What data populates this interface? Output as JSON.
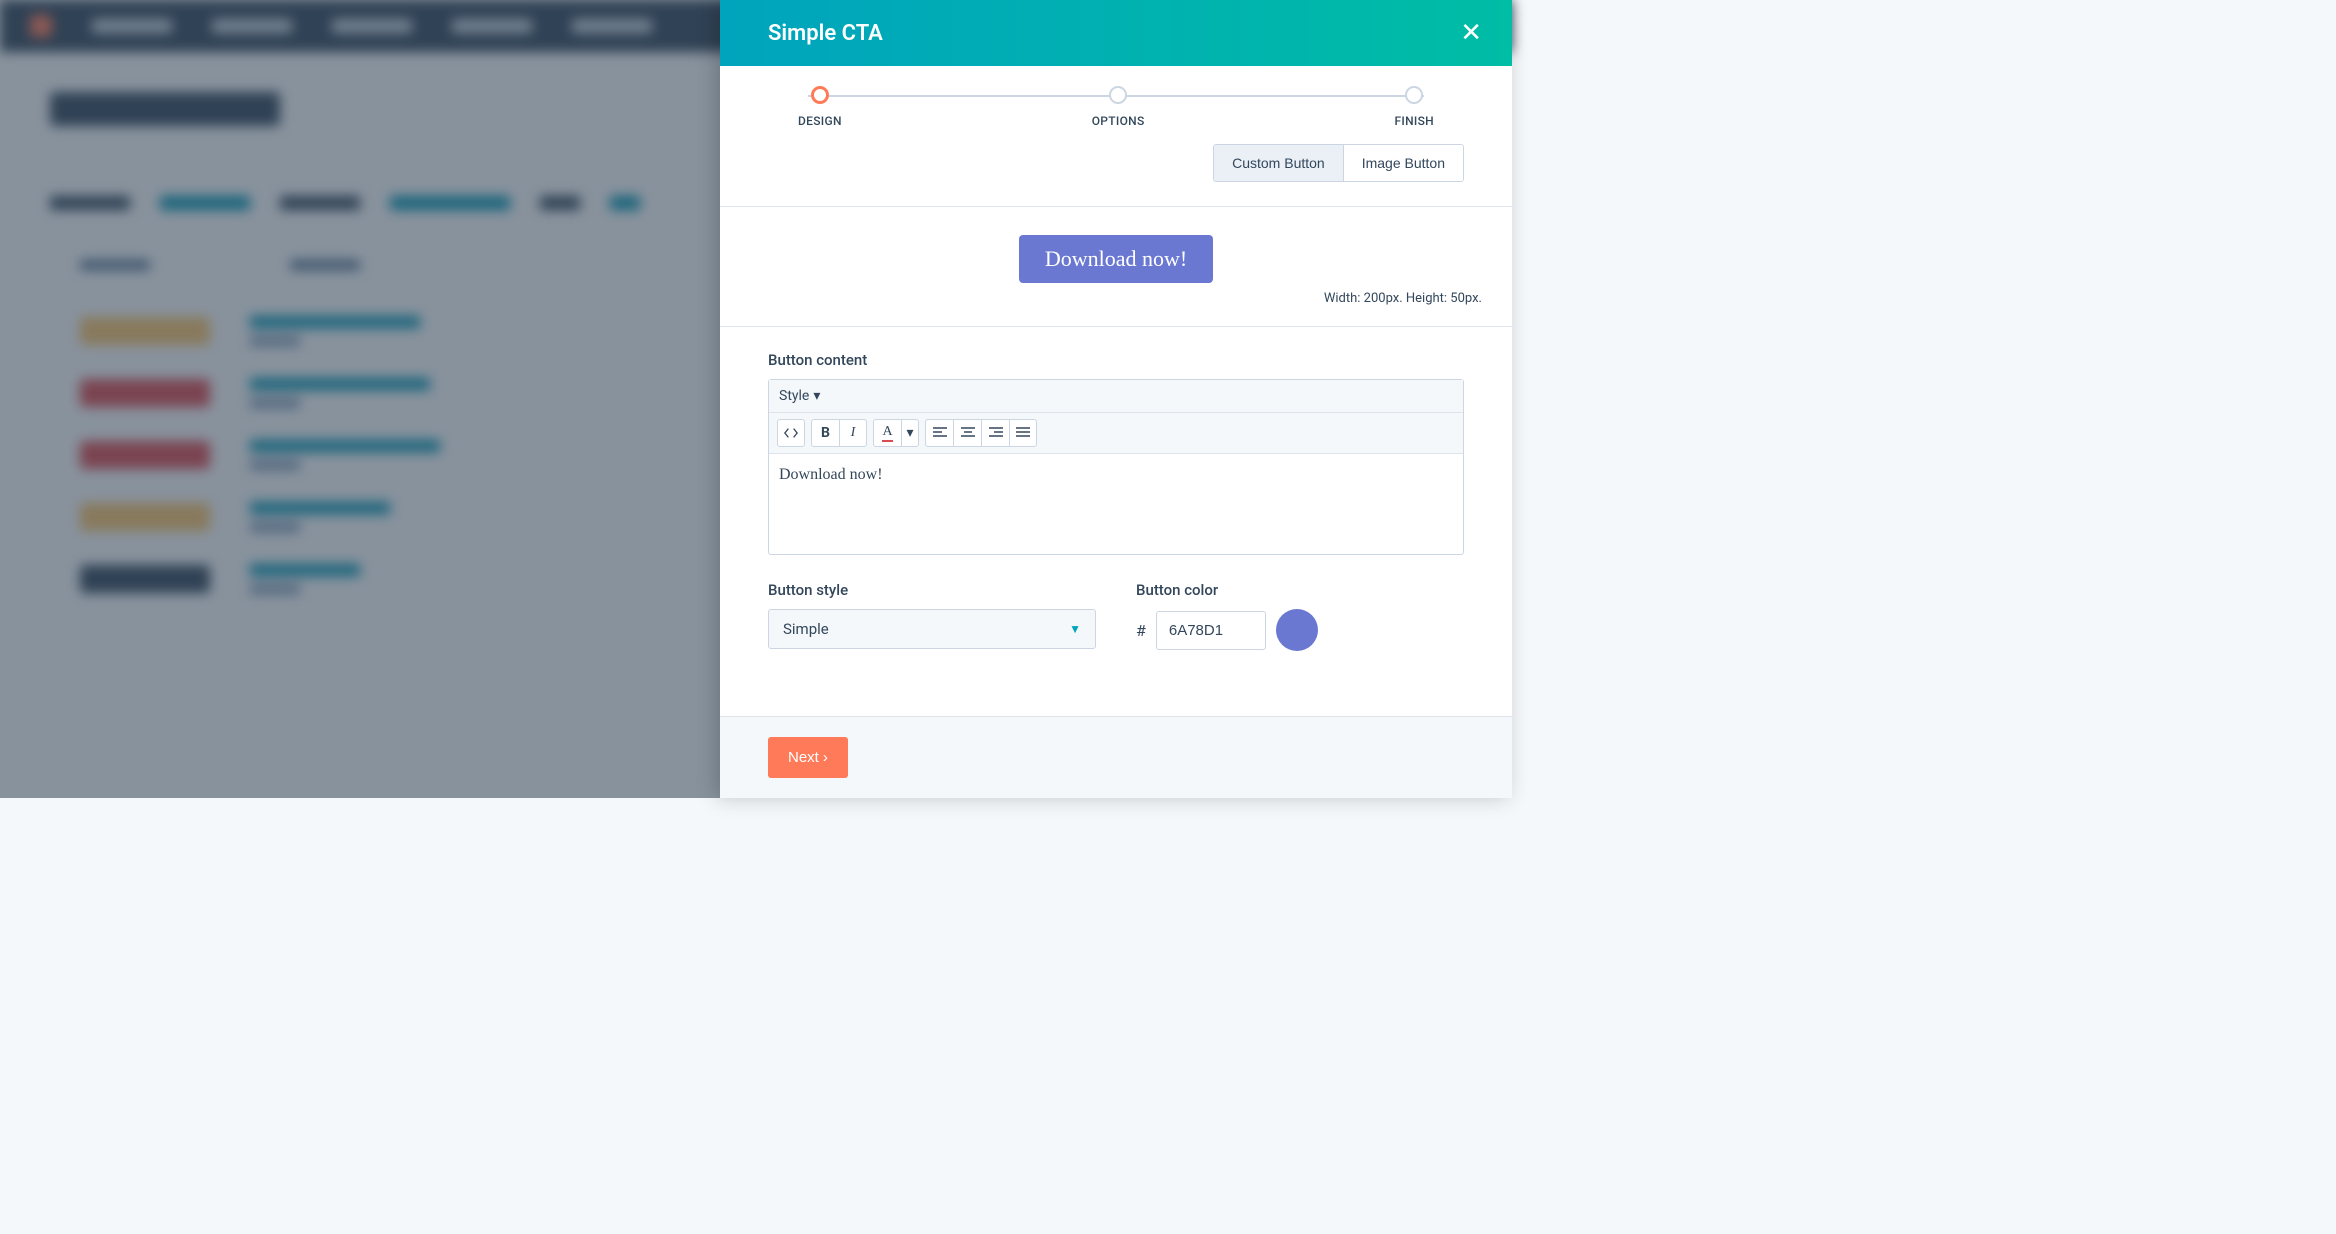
{
  "background": {
    "page_title": "Calls-to-action",
    "nav_items": [
      "Contacts",
      "Conversations",
      "Marketing",
      "Sales",
      "Service"
    ]
  },
  "drawer": {
    "title": "Simple CTA",
    "steps": [
      {
        "label": "DESIGN",
        "active": true
      },
      {
        "label": "OPTIONS",
        "active": false
      },
      {
        "label": "FINISH",
        "active": false
      }
    ],
    "button_type": {
      "options": [
        "Custom Button",
        "Image Button"
      ],
      "selected": "Custom Button"
    },
    "preview": {
      "button_text": "Download now!",
      "button_bg": "#6a78d1",
      "dimensions": "Width: 200px. Height: 50px."
    },
    "content": {
      "label": "Button content",
      "style_dropdown": "Style",
      "value": "Download now!"
    },
    "style": {
      "label": "Button style",
      "value": "Simple"
    },
    "color": {
      "label": "Button color",
      "hex": "6A78D1"
    },
    "footer": {
      "next": "Next"
    }
  }
}
